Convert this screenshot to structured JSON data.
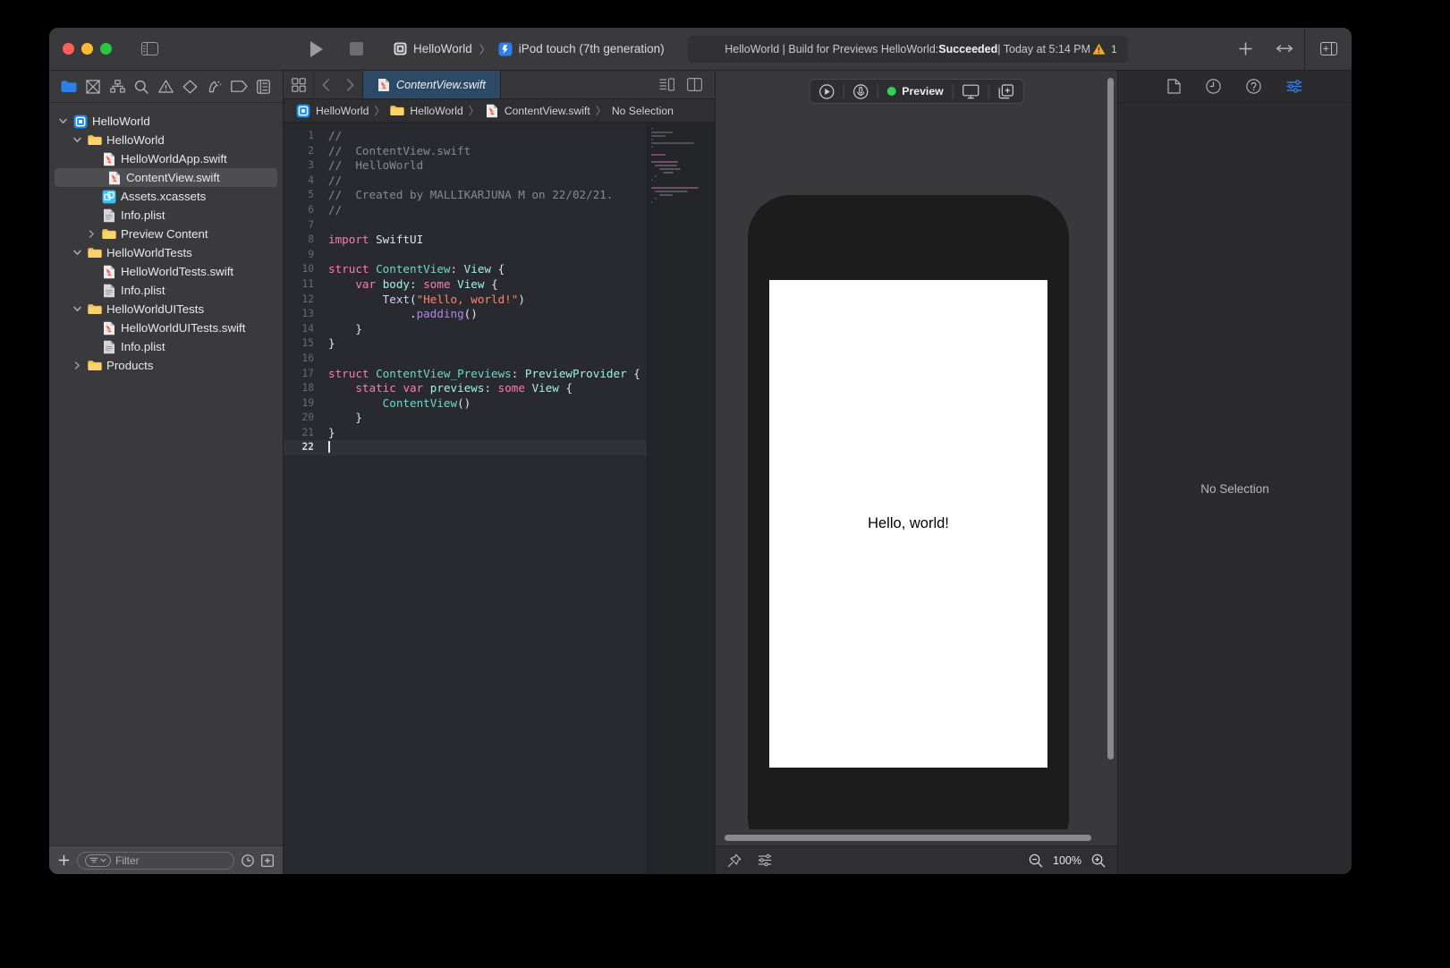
{
  "window": {
    "titlebar": {
      "traffic_lights": [
        "close",
        "minimize",
        "zoom"
      ],
      "sidebar_toggle_icon": "sidebar-left-icon",
      "run_button_icon": "play-icon",
      "stop_button_icon": "stop-icon",
      "scheme": {
        "project_name": "HelloWorld",
        "separator": "〉",
        "destination": "iPod touch (7th generation)",
        "project_icon": "xcode-project-icon",
        "destination_icon": "simulator-icon"
      },
      "status": {
        "prefix": "HelloWorld | Build for Previews HelloWorld: ",
        "result": "Succeeded",
        "suffix": " | Today at 5:14 PM",
        "warning_icon": "warning-triangle-icon",
        "warning_count": "1"
      },
      "add_button_icon": "plus-icon",
      "share_button_icon": "share-arrows-icon",
      "inspector_toggle_icon": "inspector-panel-icon"
    }
  },
  "navigator": {
    "toolbar_icons": [
      "folder-icon",
      "source-control-icon",
      "symbol-hierarchy-icon",
      "search-icon",
      "issue-warning-icon",
      "test-diamond-icon",
      "debug-icon",
      "breakpoint-tag-icon",
      "report-icon"
    ],
    "active_toolbar_icon": "folder-icon",
    "tree": [
      {
        "label": "HelloWorld",
        "icon": "xcode-project-icon",
        "depth": 0,
        "disclosure": "open",
        "selected": false
      },
      {
        "label": "HelloWorld",
        "icon": "folder-icon",
        "depth": 1,
        "disclosure": "open",
        "selected": false
      },
      {
        "label": "HelloWorldApp.swift",
        "icon": "swift-file-icon",
        "depth": 2,
        "disclosure": "none",
        "selected": false
      },
      {
        "label": "ContentView.swift",
        "icon": "swift-file-icon",
        "depth": 2,
        "disclosure": "none",
        "selected": true
      },
      {
        "label": "Assets.xcassets",
        "icon": "assets-icon",
        "depth": 2,
        "disclosure": "none",
        "selected": false
      },
      {
        "label": "Info.plist",
        "icon": "plist-file-icon",
        "depth": 2,
        "disclosure": "none",
        "selected": false
      },
      {
        "label": "Preview Content",
        "icon": "folder-icon",
        "depth": 2,
        "disclosure": "closed",
        "selected": false
      },
      {
        "label": "HelloWorldTests",
        "icon": "folder-icon",
        "depth": 1,
        "disclosure": "open",
        "selected": false
      },
      {
        "label": "HelloWorldTests.swift",
        "icon": "swift-file-icon",
        "depth": 2,
        "disclosure": "none",
        "selected": false
      },
      {
        "label": "Info.plist",
        "icon": "plist-file-icon",
        "depth": 2,
        "disclosure": "none",
        "selected": false
      },
      {
        "label": "HelloWorldUITests",
        "icon": "folder-icon",
        "depth": 1,
        "disclosure": "open",
        "selected": false
      },
      {
        "label": "HelloWorldUITests.swift",
        "icon": "swift-file-icon",
        "depth": 2,
        "disclosure": "none",
        "selected": false
      },
      {
        "label": "Info.plist",
        "icon": "plist-file-icon",
        "depth": 2,
        "disclosure": "none",
        "selected": false
      },
      {
        "label": "Products",
        "icon": "folder-icon",
        "depth": 1,
        "disclosure": "closed",
        "selected": false
      }
    ],
    "filter": {
      "add_icon": "plus-icon",
      "scope_icon": "filter-lines-icon",
      "placeholder": "Filter",
      "recent_icon": "clock-icon",
      "expand_icon": "expand-tree-icon"
    }
  },
  "editor": {
    "tabbar": {
      "grid_icon": "editor-grid-icon",
      "back_icon": "chevron-left-icon",
      "forward_icon": "chevron-right-icon",
      "active_tab": {
        "label": "ContentView.swift",
        "icon": "swift-file-icon"
      },
      "right_icons": [
        "editor-options-icon",
        "add-editor-icon"
      ]
    },
    "breadcrumb": [
      {
        "label": "HelloWorld",
        "icon": "xcode-project-icon"
      },
      {
        "label": "HelloWorld",
        "icon": "folder-icon"
      },
      {
        "label": "ContentView.swift",
        "icon": "swift-file-icon"
      },
      {
        "label": "No Selection",
        "icon": "none"
      }
    ],
    "breadcrumb_separator": "〉",
    "code": [
      {
        "n": "1",
        "tokens": [
          {
            "t": "//",
            "c": "c"
          }
        ]
      },
      {
        "n": "2",
        "tokens": [
          {
            "t": "//  ContentView.swift",
            "c": "c"
          }
        ]
      },
      {
        "n": "3",
        "tokens": [
          {
            "t": "//  HelloWorld",
            "c": "c"
          }
        ]
      },
      {
        "n": "4",
        "tokens": [
          {
            "t": "//",
            "c": "c"
          }
        ]
      },
      {
        "n": "5",
        "tokens": [
          {
            "t": "//  Created by MALLIKARJUNA M on 22/02/21.",
            "c": "c"
          }
        ]
      },
      {
        "n": "6",
        "tokens": [
          {
            "t": "//",
            "c": "c"
          }
        ]
      },
      {
        "n": "7",
        "tokens": []
      },
      {
        "n": "8",
        "tokens": [
          {
            "t": "import",
            "c": "k"
          },
          {
            "t": " SwiftUI",
            "c": "pl"
          }
        ]
      },
      {
        "n": "9",
        "tokens": []
      },
      {
        "n": "10",
        "tokens": [
          {
            "t": "struct",
            "c": "k"
          },
          {
            "t": " ",
            "c": "pl"
          },
          {
            "t": "ContentView",
            "c": "ty"
          },
          {
            "t": ": ",
            "c": "pl"
          },
          {
            "t": "View",
            "c": "t"
          },
          {
            "t": " {",
            "c": "pl"
          }
        ]
      },
      {
        "n": "11",
        "tokens": [
          {
            "t": "    ",
            "c": "pl"
          },
          {
            "t": "var",
            "c": "k"
          },
          {
            "t": " ",
            "c": "pl"
          },
          {
            "t": "body",
            "c": "v"
          },
          {
            "t": ": ",
            "c": "pl"
          },
          {
            "t": "some",
            "c": "k"
          },
          {
            "t": " ",
            "c": "pl"
          },
          {
            "t": "View",
            "c": "t"
          },
          {
            "t": " {",
            "c": "pl"
          }
        ]
      },
      {
        "n": "12",
        "tokens": [
          {
            "t": "        ",
            "c": "pl"
          },
          {
            "t": "Text",
            "c": "f"
          },
          {
            "t": "(",
            "c": "pl"
          },
          {
            "t": "\"Hello, world!\"",
            "c": "s"
          },
          {
            "t": ")",
            "c": "pl"
          }
        ]
      },
      {
        "n": "13",
        "tokens": [
          {
            "t": "            .",
            "c": "pl"
          },
          {
            "t": "padding",
            "c": "m"
          },
          {
            "t": "()",
            "c": "pl"
          }
        ]
      },
      {
        "n": "14",
        "tokens": [
          {
            "t": "    }",
            "c": "pl"
          }
        ]
      },
      {
        "n": "15",
        "tokens": [
          {
            "t": "}",
            "c": "pl"
          }
        ]
      },
      {
        "n": "16",
        "tokens": []
      },
      {
        "n": "17",
        "tokens": [
          {
            "t": "struct",
            "c": "k"
          },
          {
            "t": " ",
            "c": "pl"
          },
          {
            "t": "ContentView_Previews",
            "c": "ty"
          },
          {
            "t": ": ",
            "c": "pl"
          },
          {
            "t": "PreviewProvider",
            "c": "t"
          },
          {
            "t": " {",
            "c": "pl"
          }
        ]
      },
      {
        "n": "18",
        "tokens": [
          {
            "t": "    ",
            "c": "pl"
          },
          {
            "t": "static",
            "c": "k"
          },
          {
            "t": " ",
            "c": "pl"
          },
          {
            "t": "var",
            "c": "k"
          },
          {
            "t": " ",
            "c": "pl"
          },
          {
            "t": "previews",
            "c": "v"
          },
          {
            "t": ": ",
            "c": "pl"
          },
          {
            "t": "some",
            "c": "k"
          },
          {
            "t": " ",
            "c": "pl"
          },
          {
            "t": "View",
            "c": "t"
          },
          {
            "t": " {",
            "c": "pl"
          }
        ]
      },
      {
        "n": "19",
        "tokens": [
          {
            "t": "        ",
            "c": "pl"
          },
          {
            "t": "ContentView",
            "c": "ty"
          },
          {
            "t": "()",
            "c": "pl"
          }
        ]
      },
      {
        "n": "20",
        "tokens": [
          {
            "t": "    }",
            "c": "pl"
          }
        ]
      },
      {
        "n": "21",
        "tokens": [
          {
            "t": "}",
            "c": "pl"
          }
        ]
      },
      {
        "n": "22",
        "tokens": [],
        "current": true
      }
    ]
  },
  "canvas": {
    "toolbar": {
      "live_preview_icon": "play-circle-icon",
      "inspect_icon": "inspect-circle-icon",
      "status_label": "Preview",
      "status_color": "#2fd159",
      "device_icon": "display-icon",
      "duplicate_icon": "add-variant-icon"
    },
    "preview": {
      "device_name": "iPod touch (7th generation)",
      "screen_text": "Hello, world!"
    },
    "bottom_bar": {
      "pin_icon": "pin-icon",
      "settings_icon": "sliders-icon",
      "zoom_out_icon": "zoom-out-icon",
      "zoom_level": "100%",
      "zoom_in_icon": "zoom-in-icon"
    }
  },
  "inspector": {
    "tabs": [
      {
        "icon": "file-inspector-icon",
        "active": false
      },
      {
        "icon": "history-inspector-icon",
        "active": false
      },
      {
        "icon": "help-inspector-icon",
        "active": false
      },
      {
        "icon": "attributes-inspector-icon",
        "active": true
      }
    ],
    "empty_message": "No Selection"
  }
}
